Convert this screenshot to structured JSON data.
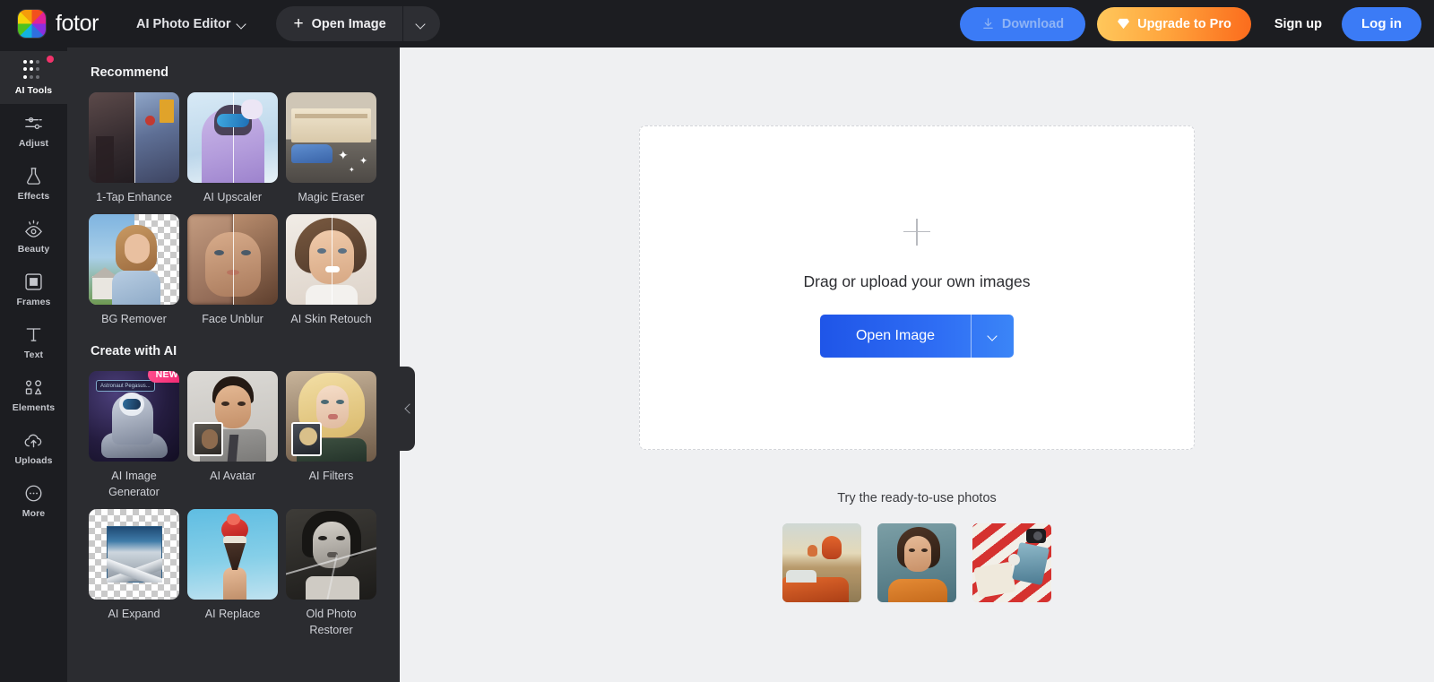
{
  "header": {
    "brand_name": "fotor",
    "logo_icon": "fotor-color-wheel-icon",
    "app_switcher": {
      "label": "AI Photo Editor",
      "caret_icon": "chevron-down-icon"
    },
    "open_image_button": {
      "label": "Open Image",
      "plus_icon": "plus-icon",
      "caret_icon": "chevron-down-icon"
    },
    "download_button": {
      "label": "Download",
      "icon": "download-icon",
      "enabled": false
    },
    "upgrade_button": {
      "label": "Upgrade to Pro",
      "icon": "diamond-icon"
    },
    "sign_up_button": {
      "label": "Sign up"
    },
    "log_in_button": {
      "label": "Log in"
    }
  },
  "sidebar": {
    "items": [
      {
        "label": "AI Tools",
        "icon": "dot-grid-icon",
        "active": true,
        "badge": true
      },
      {
        "label": "Adjust",
        "icon": "sliders-icon",
        "active": false,
        "badge": false
      },
      {
        "label": "Effects",
        "icon": "flask-icon",
        "active": false,
        "badge": false
      },
      {
        "label": "Beauty",
        "icon": "eye-icon",
        "active": false,
        "badge": false
      },
      {
        "label": "Frames",
        "icon": "frame-icon",
        "active": false,
        "badge": false
      },
      {
        "label": "Text",
        "icon": "text-t-icon",
        "active": false,
        "badge": false
      },
      {
        "label": "Elements",
        "icon": "shapes-icon",
        "active": false,
        "badge": false
      },
      {
        "label": "Uploads",
        "icon": "cloud-upload-icon",
        "active": false,
        "badge": false
      },
      {
        "label": "More",
        "icon": "ellipsis-circle-icon",
        "active": false,
        "badge": false
      }
    ]
  },
  "tools_panel": {
    "collapse_handle_icon": "chevron-left-icon",
    "sections": [
      {
        "title": "Recommend",
        "tiles": [
          {
            "label": "1-Tap Enhance",
            "art": "street-split"
          },
          {
            "label": "AI Upscaler",
            "art": "skier-split"
          },
          {
            "label": "Magic Eraser",
            "art": "building-car"
          },
          {
            "label": "BG Remover",
            "art": "bg-remove"
          },
          {
            "label": "Face Unblur",
            "art": "face-blur-split"
          },
          {
            "label": "AI Skin Retouch",
            "art": "skin-split"
          }
        ]
      },
      {
        "title": "Create with AI",
        "tiles": [
          {
            "label": "AI Image Generator",
            "art": "astronaut",
            "badge": "NEW",
            "prompt_chip": "Astronaut  Pegasus..."
          },
          {
            "label": "AI Avatar",
            "art": "avatar-man"
          },
          {
            "label": "AI Filters",
            "art": "blonde-woman"
          },
          {
            "label": "AI Expand",
            "art": "mountain-expand"
          },
          {
            "label": "AI Replace",
            "art": "icecream"
          },
          {
            "label": "Old Photo Restorer",
            "art": "old-photo"
          }
        ]
      }
    ]
  },
  "canvas": {
    "dropzone": {
      "plus_icon": "plus-icon",
      "text": "Drag or upload your own images",
      "button_label": "Open Image",
      "button_caret_icon": "chevron-down-icon"
    },
    "ready_photos": {
      "title": "Try the ready-to-use photos",
      "items": [
        {
          "art": "balloons-car"
        },
        {
          "art": "portrait-woman"
        },
        {
          "art": "picnic-blanket"
        }
      ]
    }
  },
  "colors": {
    "header_bg": "#1c1d21",
    "panel_bg": "#2b2c30",
    "canvas_bg": "#eff0f2",
    "accent_blue": "#3b7bf6",
    "upgrade_orange": "#fb6b1c",
    "badge_pink": "#f2336b"
  }
}
